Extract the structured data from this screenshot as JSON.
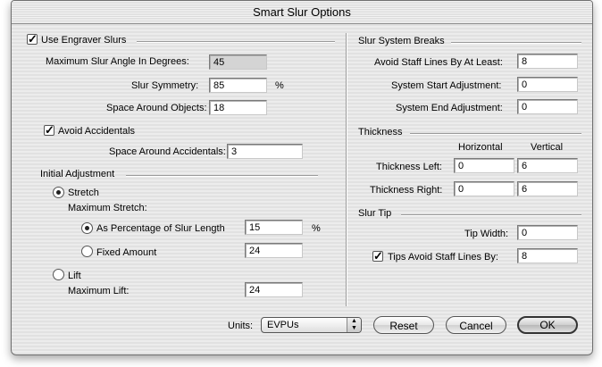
{
  "window": {
    "title": "Smart Slur Options"
  },
  "left": {
    "use_engraver_slurs": {
      "label": "Use Engraver Slurs",
      "checked": true
    },
    "max_slur_angle": {
      "label": "Maximum Slur Angle In Degrees:",
      "value": "45"
    },
    "slur_symmetry": {
      "label": "Slur Symmetry:",
      "value": "85",
      "unit": "%"
    },
    "space_around_objects": {
      "label": "Space Around Objects:",
      "value": "18"
    },
    "avoid_accidentals": {
      "label": "Avoid Accidentals",
      "checked": true
    },
    "space_around_accidentals": {
      "label": "Space Around Accidentals:",
      "value": "3"
    },
    "initial_adjustment": {
      "title": "Initial Adjustment",
      "stretch": {
        "label": "Stretch",
        "selected": true
      },
      "maximum_stretch_label": "Maximum Stretch:",
      "as_percentage": {
        "label": "As Percentage of Slur Length",
        "value": "15",
        "unit": "%",
        "selected": true
      },
      "fixed_amount": {
        "label": "Fixed Amount",
        "value": "24",
        "selected": false
      },
      "lift": {
        "label": "Lift",
        "selected": false
      },
      "maximum_lift": {
        "label": "Maximum Lift:",
        "value": "24"
      }
    }
  },
  "right": {
    "system_breaks": {
      "title": "Slur System Breaks",
      "avoid_staff_lines": {
        "label": "Avoid Staff Lines By At Least:",
        "value": "8"
      },
      "system_start": {
        "label": "System Start Adjustment:",
        "value": "0"
      },
      "system_end": {
        "label": "System End Adjustment:",
        "value": "0"
      }
    },
    "thickness": {
      "title": "Thickness",
      "col_horizontal": "Horizontal",
      "col_vertical": "Vertical",
      "left": {
        "label": "Thickness Left:",
        "horizontal": "0",
        "vertical": "6"
      },
      "right": {
        "label": "Thickness Right:",
        "horizontal": "0",
        "vertical": "6"
      }
    },
    "slur_tip": {
      "title": "Slur Tip",
      "tip_width": {
        "label": "Tip Width:",
        "value": "0"
      },
      "tips_avoid": {
        "label": "Tips Avoid Staff Lines By:",
        "value": "8",
        "checked": true
      }
    }
  },
  "footer": {
    "units_label": "Units:",
    "units_value": "EVPUs",
    "reset": "Reset",
    "cancel": "Cancel",
    "ok": "OK"
  },
  "icons": {
    "check": "checkmark-glyph",
    "select_arrows": "up-down-arrows"
  }
}
